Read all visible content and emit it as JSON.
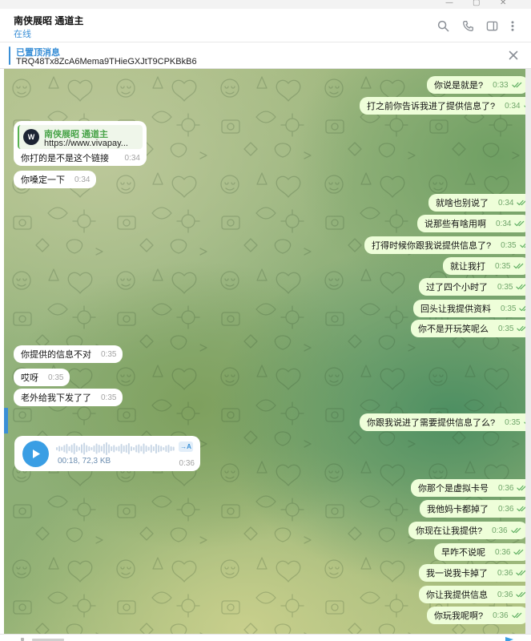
{
  "header": {
    "title": "南侠展昭 通道主",
    "status": "在线",
    "icons": [
      "search-icon",
      "phone-icon",
      "sidebar-toggle-icon",
      "more-vertical-icon"
    ]
  },
  "pinned": {
    "label": "已置顶消息",
    "text": "TRQ48Tx8ZcA6Mema9THieGXJtT9CPKBkB6"
  },
  "messages": {
    "out": [
      {
        "text": "你说是就是?",
        "time": "0:33"
      },
      {
        "text": "打之前你告诉我进了提供信息了?",
        "time": "0:34"
      },
      {
        "text": "就啥也别说了",
        "time": "0:34"
      },
      {
        "text": "说那些有啥用啊",
        "time": "0:34"
      },
      {
        "text": "打得时候你跟我说提供信息了?",
        "time": "0:35"
      },
      {
        "text": "就让我打",
        "time": "0:35"
      },
      {
        "text": "过了四个小时了",
        "time": "0:35"
      },
      {
        "text": "回头让我提供资料",
        "time": "0:35"
      },
      {
        "text": "你不是开玩笑呢么",
        "time": "0:35"
      },
      {
        "text": "你跟我说进了需要提供信息了么?",
        "time": "0:35"
      },
      {
        "text": "你那个是虚拟卡号",
        "time": "0:36"
      },
      {
        "text": "我他妈卡都掉了",
        "time": "0:36"
      },
      {
        "text": "你现在让我提供?",
        "time": "0:36"
      },
      {
        "text": "早咋不说呢",
        "time": "0:36"
      },
      {
        "text": "我一说我卡掉了",
        "time": "0:36"
      },
      {
        "text": "你让我提供信息",
        "time": "0:36"
      },
      {
        "text": "你玩我呢啊?",
        "time": "0:36"
      }
    ],
    "in": [
      {
        "text": "你嗓定一下",
        "time": "0:34"
      },
      {
        "text": "你提供的信息不对",
        "time": "0:35"
      },
      {
        "text": "哎呀",
        "time": "0:35"
      },
      {
        "text": "老外给我下发了了",
        "time": "0:35"
      }
    ],
    "link": {
      "preview_title": "南侠展昭 通道主",
      "preview_url": "https://www.vivapay...",
      "logo_letter": "W",
      "text": "你打的是不是这个链接",
      "time": "0:34"
    },
    "voice": {
      "duration_size": "00:18, 72,3 KB",
      "time": "0:36",
      "transcribe_label": "→A"
    }
  },
  "colors": {
    "accent": "#3a8fd6",
    "outgoing_bubble": "#eefed9",
    "incoming_bubble": "#ffffff",
    "check": "#5fae62",
    "link_title": "#4aa44a"
  }
}
